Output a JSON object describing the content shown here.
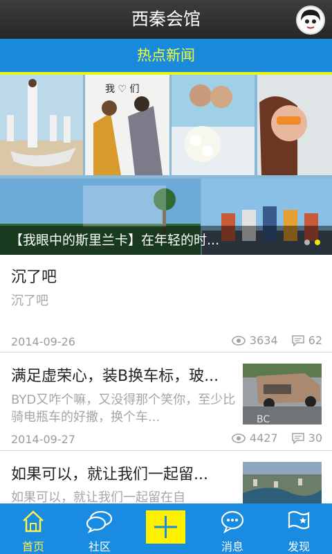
{
  "app": {
    "title": "西秦会馆"
  },
  "section": {
    "title": "热点新闻"
  },
  "banner": {
    "caption": "【我眼中的斯里兰卡】在年轻的时...",
    "indicator": {
      "count": 2,
      "active_index": 1,
      "active_color": "#f5e50a"
    }
  },
  "articles": [
    {
      "title": "沉了吧",
      "summary": "沉了吧",
      "date": "2014-09-26",
      "views": "3634",
      "comments": "62"
    },
    {
      "title": "满足虚荣心，装B换车标，玻...",
      "summary": "BYD又咋个嘛，又没得那个笑你，至少比骑电瓶车的好撒，换个车...",
      "date": "2014-09-27",
      "views": "4427",
      "comments": "30"
    },
    {
      "title": "如果可以，就让我们一起留...",
      "summary": "如果可以，就让我们一起留在自"
    }
  ],
  "tabs": [
    {
      "label": "首页",
      "icon": "home-icon",
      "active": true
    },
    {
      "label": "社区",
      "icon": "chat-bubbles-icon"
    },
    {
      "label": "",
      "icon": "plus-icon"
    },
    {
      "label": "消息",
      "icon": "message-icon"
    },
    {
      "label": "发现",
      "icon": "discover-flag-icon"
    }
  ],
  "colors": {
    "titlebar": "#2f2f2f",
    "primary": "#1a8bdc",
    "accent": "#f4ff38",
    "plus": "#fff000"
  }
}
